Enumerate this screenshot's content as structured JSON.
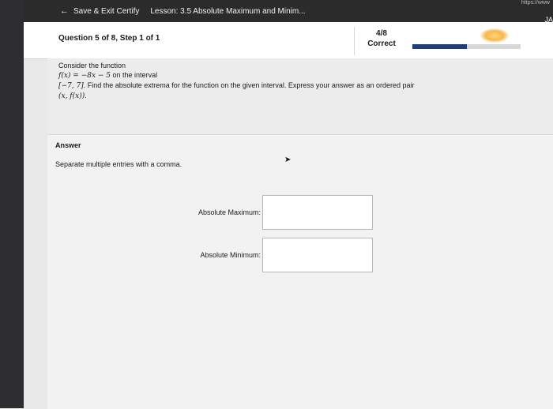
{
  "topbar": {
    "back_label": "Save & Exit Certify",
    "lesson": "Lesson: 3.5 Absolute Maximum and Minim...",
    "url_fragment": "https://www",
    "user_initials": "JA"
  },
  "header": {
    "question_info": "Question 5 of 8, Step 1 of 1",
    "score_value": "4/8",
    "score_label": "Correct",
    "progress_fraction": 0.5
  },
  "question": {
    "line1": "Consider the function",
    "function": "f(x) = −8x − 5",
    "line2_suffix": " on the interval",
    "interval": "[−7, 7]",
    "line3_suffix": ". Find the absolute extrema for the function on the given interval. Express your answer as an ordered pair",
    "pair": "(x, f(x))",
    "pair_suffix": "."
  },
  "answer": {
    "title": "Answer",
    "hint": "Separate multiple entries with a comma.",
    "max_label": "Absolute Maximum:",
    "max_value": "",
    "min_label": "Absolute Minimum:",
    "min_value": ""
  }
}
